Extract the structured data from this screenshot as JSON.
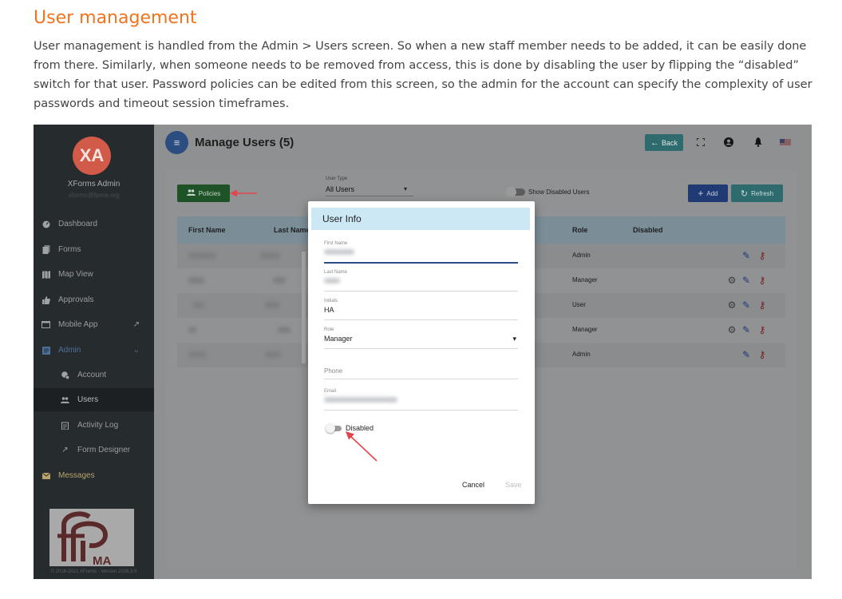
{
  "doc": {
    "title": "User management",
    "paragraph": "User management is handled from the Admin > Users screen.  So when a new staff member needs to be added, it can be easily done from there.  Similarly, when someone needs to be removed from access, this is done by disabling the user by flipping the “disabled” switch for that user.  Password policies can be edited from this screen, so the admin for the account can specify the complexity of user passwords and timeout session timeframes."
  },
  "sidebar": {
    "avatar_initials": "XA",
    "user_name": "XForms Admin",
    "user_email": "xforms@fpma.org",
    "items": [
      {
        "label": "Dashboard",
        "icon": "dashboard-icon"
      },
      {
        "label": "Forms",
        "icon": "forms-icon"
      },
      {
        "label": "Map View",
        "icon": "map-icon"
      },
      {
        "label": "Approvals",
        "icon": "thumbs-up-icon"
      },
      {
        "label": "Mobile App",
        "icon": "mobile-app-icon"
      },
      {
        "label": "Admin",
        "icon": "admin-icon"
      },
      {
        "label": "Account",
        "icon": "account-icon"
      },
      {
        "label": "Users",
        "icon": "users-icon"
      },
      {
        "label": "Activity Log",
        "icon": "activity-log-icon"
      },
      {
        "label": "Form Designer",
        "icon": "form-designer-icon"
      },
      {
        "label": "Messages",
        "icon": "messages-icon"
      }
    ],
    "logo_text": "MA",
    "copyright": "© 2016-2021 XForms - Version 2026.3.0"
  },
  "topbar": {
    "title": "Manage Users (5)",
    "back_label": "Back"
  },
  "toolbar": {
    "policies_label": "Policies",
    "user_type_label": "User Type",
    "user_type_value": "All Users",
    "show_disabled_label": "Show Disabled Users",
    "add_label": "Add",
    "refresh_label": "Refresh"
  },
  "table": {
    "headers": [
      "First Name",
      "Last Name",
      "Role",
      "Disabled"
    ],
    "rows": [
      {
        "role": "Admin",
        "gear": false
      },
      {
        "role": "Manager",
        "gear": true
      },
      {
        "role": "User",
        "gear": true
      },
      {
        "role": "Manager",
        "gear": true
      },
      {
        "role": "Admin",
        "gear": false
      }
    ]
  },
  "dialog": {
    "title": "User Info",
    "first_name_label": "First Name",
    "last_name_label": "Last Name",
    "initials_label": "Initials",
    "initials_value": "HA",
    "role_label": "Role",
    "role_value": "Manager",
    "phone_label": "Phone",
    "email_label": "Email",
    "disabled_label": "Disabled",
    "cancel_label": "Cancel",
    "save_label": "Save"
  },
  "colors": {
    "accent_orange": "#f0731e",
    "arrow_red": "#e2454b",
    "dialog_header": "#cde8f5"
  }
}
